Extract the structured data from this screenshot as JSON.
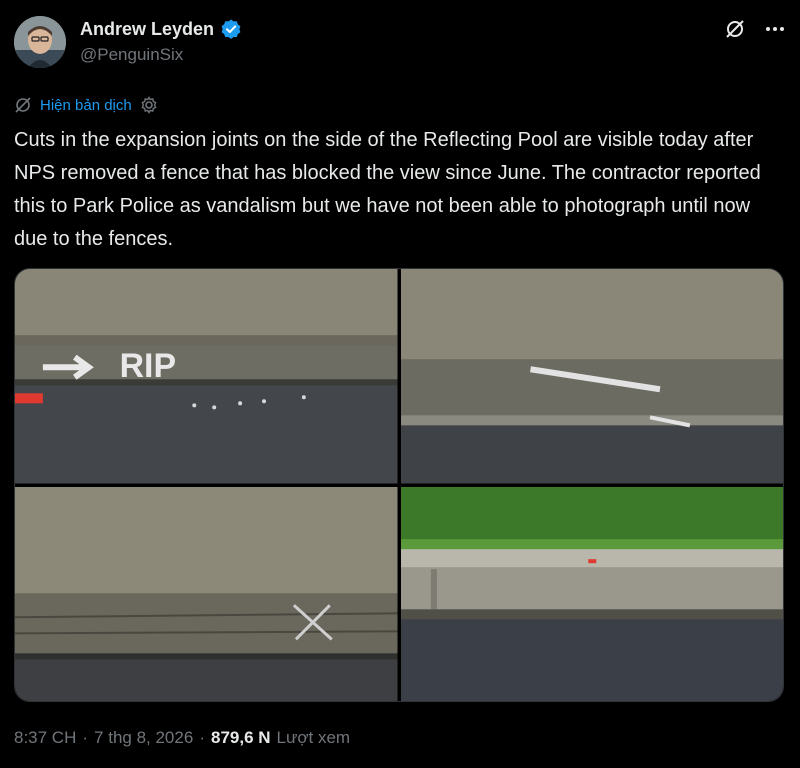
{
  "author": {
    "display_name": "Andrew Leyden",
    "handle": "@PenguinSix",
    "verified": true,
    "verified_color": "#1d9bf0"
  },
  "header_actions": {
    "grok_icon": "grok-slash-icon",
    "more_icon": "more-dots-icon"
  },
  "translate": {
    "label": "Hiện bản dịch",
    "icon": "translate-slash-icon",
    "settings_icon": "gear-icon"
  },
  "tweet": {
    "text": "Cuts in the expansion joints on the side of the Reflecting Pool are visible today after NPS removed a fence that has blocked the view since June. The contractor reported this to Park Police as vandalism but we have not been able to photograph until now due to the fences."
  },
  "media": {
    "photos": [
      {
        "description": "curb-with-RIP-marking"
      },
      {
        "description": "curb-with-arrow-marking"
      },
      {
        "description": "curb-with-x-marking"
      },
      {
        "description": "curb-with-grass"
      }
    ]
  },
  "footer": {
    "time": "8:37 CH",
    "separator1": "·",
    "date": "7 thg 8, 2026",
    "separator2": "·",
    "views_count": "879,6 N",
    "views_label": "Lượt xem"
  },
  "colors": {
    "background": "#000000",
    "text": "#e7e9ea",
    "secondary": "#71767b",
    "accent": "#1d9bf0"
  }
}
